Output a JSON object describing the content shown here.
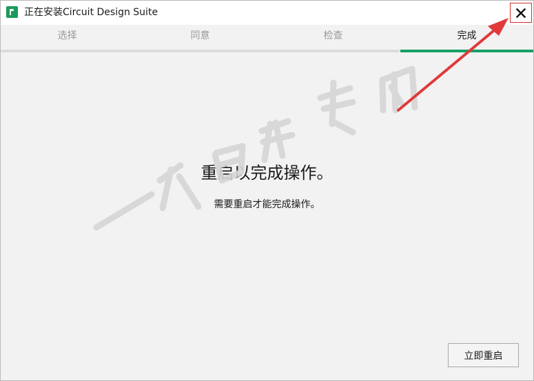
{
  "window": {
    "title": "正在安装Circuit Design Suite",
    "app_icon": "ni-app-icon",
    "close_icon": "close-icon"
  },
  "steps": [
    {
      "label": "选择",
      "active": false
    },
    {
      "label": "同意",
      "active": false
    },
    {
      "label": "检查",
      "active": false
    },
    {
      "label": "完成",
      "active": true
    }
  ],
  "content": {
    "heading": "重启以完成操作。",
    "message": "需要重启才能完成操作。"
  },
  "actions": {
    "restart_label": "立即重启"
  },
  "watermark": {
    "text": "一个白开专用"
  },
  "colors": {
    "accent": "#17a067",
    "annotation": "#e03a3a"
  }
}
